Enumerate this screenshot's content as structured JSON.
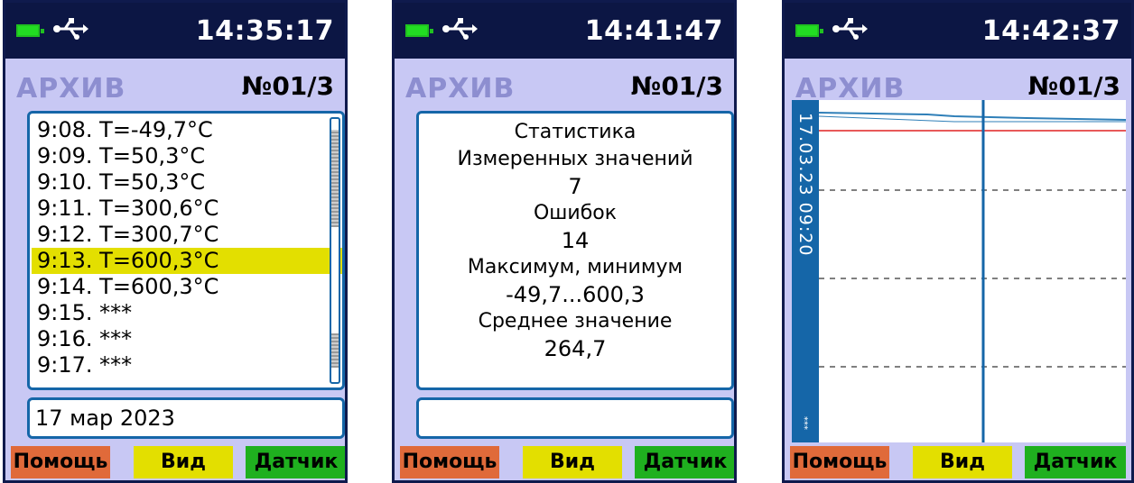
{
  "screens": [
    {
      "clock": "14:35:17",
      "title": "АРХИВ",
      "record": "№01/3",
      "items": [
        "9:08. T=-49,7°C",
        "9:09. T=50,3°C",
        "9:10. T=50,3°C",
        "9:11. T=300,6°C",
        "9:12. T=300,7°C",
        "9:13. T=600,3°C",
        "9:14. T=600,3°C",
        "9:15. ***",
        "9:16. ***",
        "9:17. ***"
      ],
      "selected_index": 5,
      "date": "17 мар 2023",
      "softkeys": [
        "Помощь",
        "Вид",
        "Датчик"
      ]
    },
    {
      "clock": "14:41:47",
      "title": "АРХИВ",
      "record": "№01/3",
      "stats": {
        "heading1": "Статистика",
        "heading2": "Измеренных значений",
        "count": "7",
        "errors_label": "Ошибок",
        "errors": "14",
        "minmax_label": "Максимум, минимум",
        "minmax": "-49,7...600,3",
        "avg_label": "Среднее значение",
        "avg": "264,7"
      },
      "softkeys": [
        "Помощь",
        "Вид",
        "Датчик"
      ]
    },
    {
      "clock": "14:42:37",
      "title": "АРХИВ",
      "record": "№01/3",
      "axis_time": "17.03.23 09:20",
      "axis_marker": "***",
      "softkeys": [
        "Помощь",
        "Вид",
        "Датчик"
      ]
    }
  ],
  "colors": {
    "statusbar": "#0c1644",
    "screen_bg": "#c8c8f4",
    "selected": "#e3df00",
    "help_key": "#e06a3a",
    "view_key": "#e3df00",
    "sensor_key": "#1fb01f",
    "accent": "#1566a8"
  }
}
